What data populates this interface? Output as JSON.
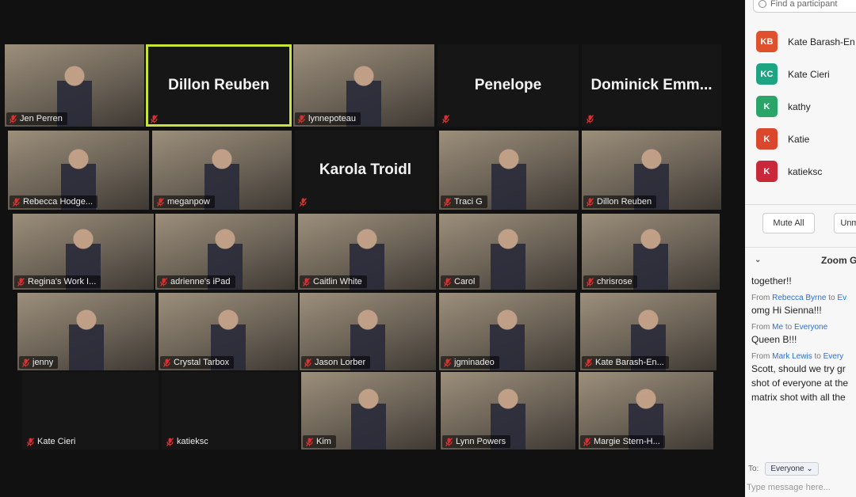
{
  "colors": {
    "speaker_border": "#c8e43a",
    "muted_mic": "#e02d2d"
  },
  "tiles": [
    {
      "label": "Jen Perren",
      "big_name": ""
    },
    {
      "label": "",
      "big_name": "Dillon Reuben"
    },
    {
      "label": "lynnepoteau",
      "big_name": ""
    },
    {
      "label": "",
      "big_name": "Penelope"
    },
    {
      "label": "",
      "big_name": "Dominick  Emm..."
    },
    {
      "label": "Rebecca Hodge...",
      "big_name": ""
    },
    {
      "label": "meganpow",
      "big_name": ""
    },
    {
      "label": "",
      "big_name": "Karola Troidl"
    },
    {
      "label": "Traci G",
      "big_name": ""
    },
    {
      "label": "Dillon Reuben",
      "big_name": ""
    },
    {
      "label": "Regina's Work I...",
      "big_name": ""
    },
    {
      "label": "adrienne's iPad",
      "big_name": ""
    },
    {
      "label": "Caitlin White",
      "big_name": ""
    },
    {
      "label": "Carol",
      "big_name": ""
    },
    {
      "label": "chrisrose",
      "big_name": ""
    },
    {
      "label": "jenny",
      "big_name": ""
    },
    {
      "label": "Crystal Tarbox",
      "big_name": ""
    },
    {
      "label": "Jason Lorber",
      "big_name": ""
    },
    {
      "label": "jgminadeo",
      "big_name": ""
    },
    {
      "label": "Kate Barash-En...",
      "big_name": ""
    },
    {
      "label": "Kate Cieri",
      "big_name": ""
    },
    {
      "label": "katieksc",
      "big_name": ""
    },
    {
      "label": "Kim",
      "big_name": ""
    },
    {
      "label": "Lynn Powers",
      "big_name": ""
    },
    {
      "label": "Margie Stern-H...",
      "big_name": ""
    }
  ],
  "sidebar": {
    "search_placeholder": "Find a participant",
    "participants": [
      {
        "initials": "KB",
        "name": "Kate Barash-En",
        "color": "#e0502c"
      },
      {
        "initials": "KC",
        "name": "Kate Cieri",
        "color": "#1ea383"
      },
      {
        "initials": "K",
        "name": "kathy",
        "color": "#2aa56a"
      },
      {
        "initials": "K",
        "name": "Katie",
        "color": "#d9472c"
      },
      {
        "initials": "K",
        "name": "katieksc",
        "color": "#c9283a"
      }
    ],
    "mute_all": "Mute All",
    "unmute_all": "Unm",
    "chat_title": "Zoom G",
    "messages": [
      {
        "from": "",
        "to": "",
        "text": "together!!"
      },
      {
        "from": "Rebecca Byrne",
        "to": "Ev",
        "text": "omg Hi Sienna!!!"
      },
      {
        "from": "Me",
        "to": "Everyone",
        "text": "Queen B!!!"
      },
      {
        "from": "Mark Lewis",
        "to": "Every",
        "text": "Scott, should we try gr"
      }
    ],
    "extra_lines": [
      "shot of everyone at the",
      "matrix shot with all the"
    ],
    "from_label": "From",
    "to_word": "to",
    "to_label": "To:",
    "to_value": "Everyone",
    "input_placeholder": "Type message here..."
  }
}
